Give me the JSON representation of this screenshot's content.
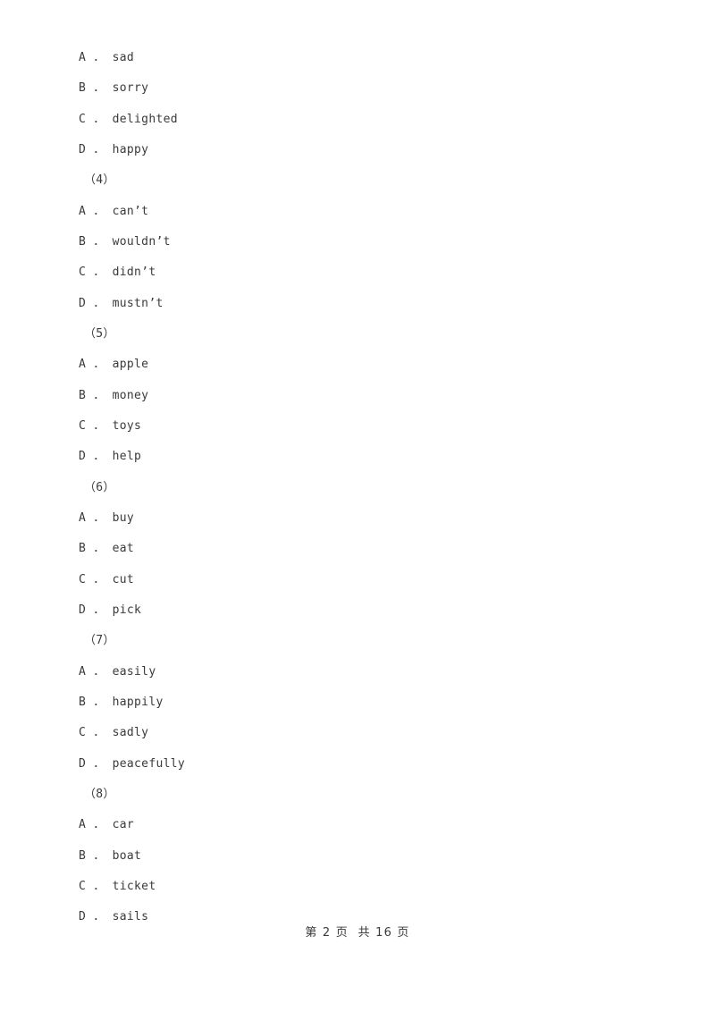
{
  "document": {
    "background_color": "#ffffff",
    "text_color": "#3a3a3a"
  },
  "body_lines": [
    {
      "kind": "option",
      "text": "A ． sad"
    },
    {
      "kind": "option",
      "text": "B ． sorry"
    },
    {
      "kind": "option",
      "text": "C ． delighted"
    },
    {
      "kind": "option",
      "text": "D ． happy"
    },
    {
      "kind": "qnum",
      "text": "（4）"
    },
    {
      "kind": "option",
      "text": "A ． can’t"
    },
    {
      "kind": "option",
      "text": "B ． wouldn’t"
    },
    {
      "kind": "option",
      "text": "C ． didn’t"
    },
    {
      "kind": "option",
      "text": "D ． mustn’t"
    },
    {
      "kind": "qnum",
      "text": "（5）"
    },
    {
      "kind": "option",
      "text": "A ． apple"
    },
    {
      "kind": "option",
      "text": "B ． money"
    },
    {
      "kind": "option",
      "text": "C ． toys"
    },
    {
      "kind": "option",
      "text": "D ． help"
    },
    {
      "kind": "qnum",
      "text": "（6）"
    },
    {
      "kind": "option",
      "text": "A ． buy"
    },
    {
      "kind": "option",
      "text": "B ． eat"
    },
    {
      "kind": "option",
      "text": "C ． cut"
    },
    {
      "kind": "option",
      "text": "D ． pick"
    },
    {
      "kind": "qnum",
      "text": "（7）"
    },
    {
      "kind": "option",
      "text": "A ． easily"
    },
    {
      "kind": "option",
      "text": "B ． happily"
    },
    {
      "kind": "option",
      "text": "C ． sadly"
    },
    {
      "kind": "option",
      "text": "D ． peacefully"
    },
    {
      "kind": "qnum",
      "text": "（8）"
    },
    {
      "kind": "option",
      "text": "A ． car"
    },
    {
      "kind": "option",
      "text": "B ． boat"
    },
    {
      "kind": "option",
      "text": "C ． ticket"
    },
    {
      "kind": "option",
      "text": "D ． sails"
    }
  ],
  "footer": {
    "text": "第 2 页  共 16 页",
    "current_page": "2",
    "total_pages": "16"
  }
}
